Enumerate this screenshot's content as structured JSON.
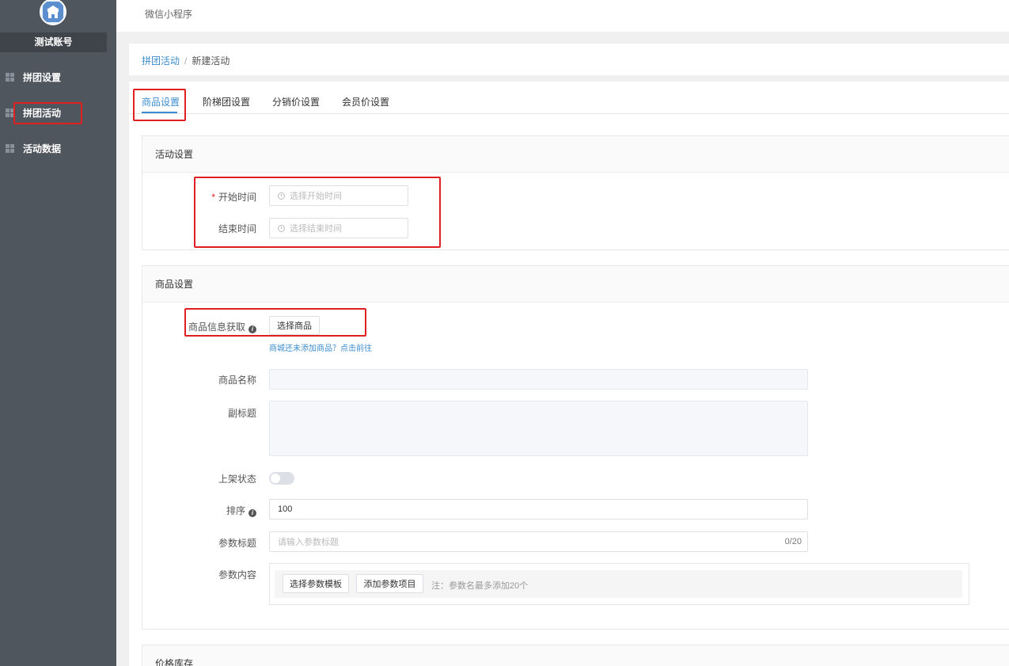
{
  "app": {
    "title": "微信小程序"
  },
  "sidebar": {
    "account": "测试账号",
    "items": [
      {
        "label": "拼团设置",
        "icon": "grid-icon"
      },
      {
        "label": "拼团活动",
        "icon": "grid-icon",
        "active": true
      },
      {
        "label": "活动数据",
        "icon": "grid-icon"
      }
    ]
  },
  "breadcrumb": {
    "parent": "拼团活动",
    "current": "新建活动"
  },
  "tabs": [
    {
      "label": "商品设置",
      "active": true
    },
    {
      "label": "阶梯团设置"
    },
    {
      "label": "分销价设置"
    },
    {
      "label": "会员价设置"
    }
  ],
  "activity": {
    "header": "活动设置",
    "start_label": "开始时间",
    "start_placeholder": "选择开始时间",
    "end_label": "结束时间",
    "end_placeholder": "选择结束时间"
  },
  "goods": {
    "header": "商品设置",
    "fetch_label": "商品信息获取",
    "select_button": "选择商品",
    "hint": "商城还未添加商品？点击前往",
    "name_label": "商品名称",
    "subtitle_label": "副标题",
    "status_label": "上架状态",
    "status_on": false,
    "sort_label": "排序",
    "sort_value": "100",
    "param_title_label": "参数标题",
    "param_title_placeholder": "请输入参数标题",
    "param_title_count": "0/20",
    "param_content_label": "参数内容",
    "template_button": "选择参数模板",
    "add_param_button": "添加参数项目",
    "param_note": "注：参数名最多添加20个"
  },
  "price": {
    "header": "价格库存"
  },
  "colors": {
    "accent": "#3c8dce",
    "highlight": "#e02020",
    "sidebar": "#50565e"
  }
}
